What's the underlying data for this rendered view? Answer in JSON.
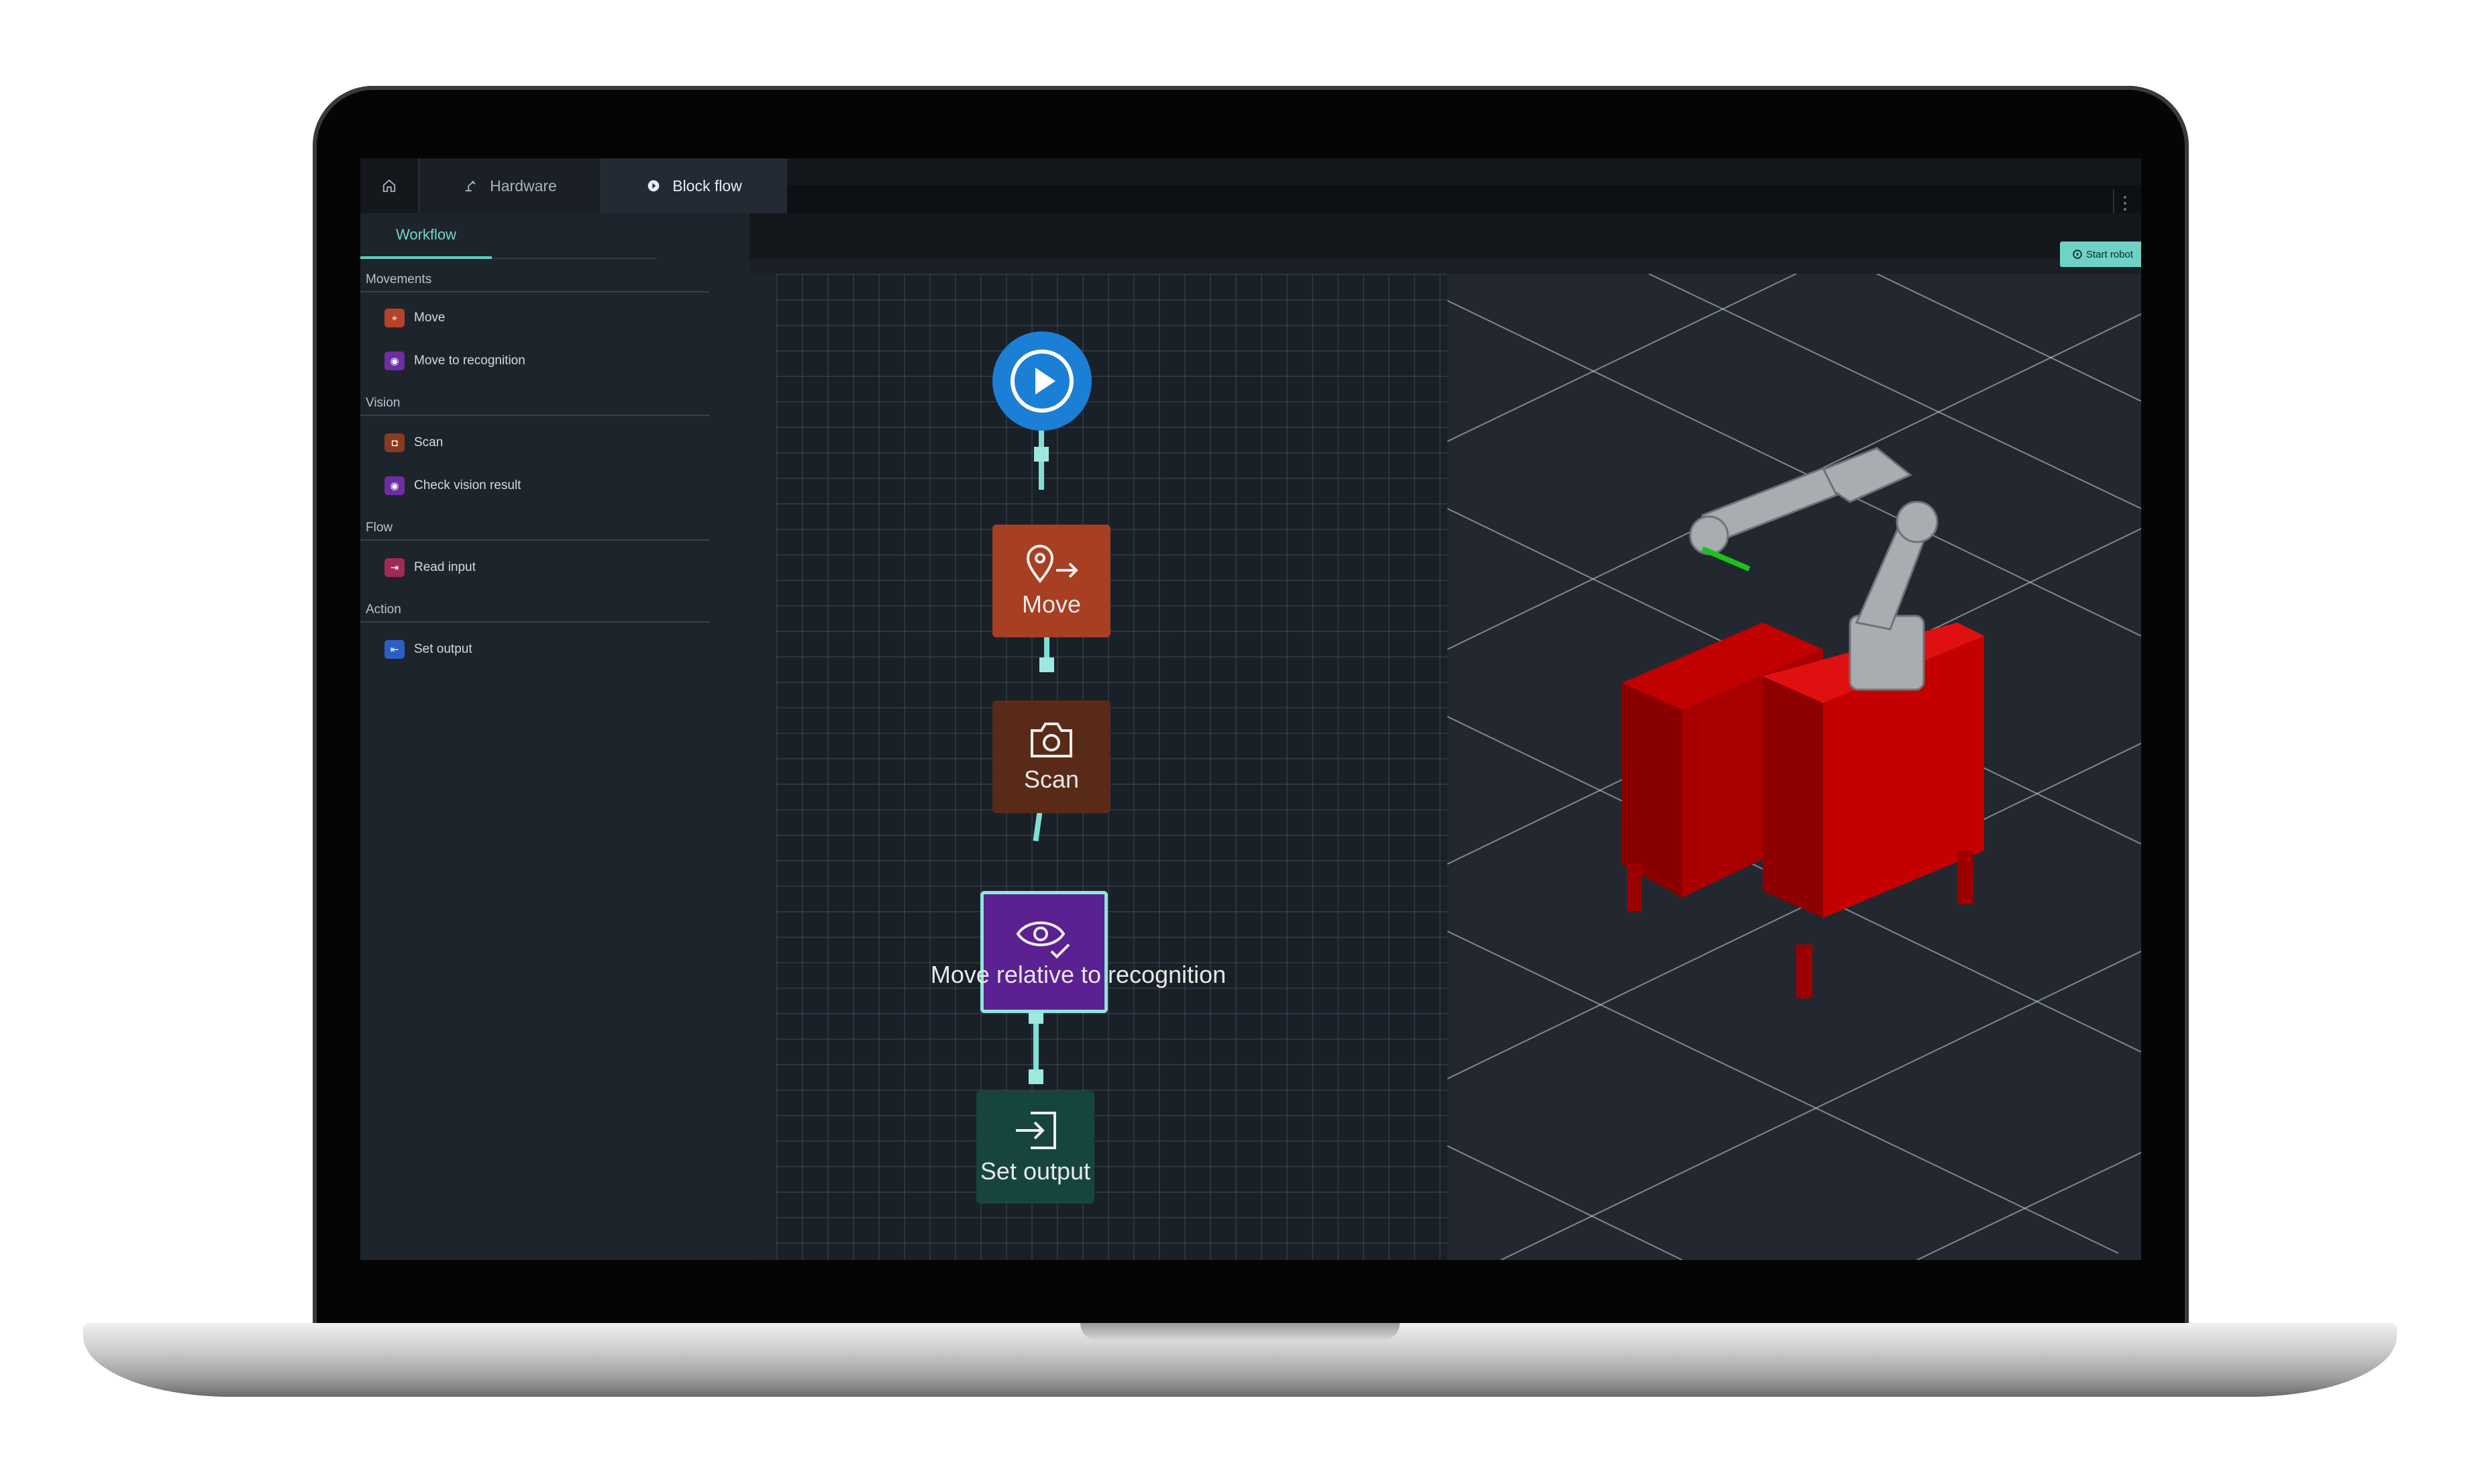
{
  "tabs": [
    {
      "label": "Hardware"
    },
    {
      "label": "Block flow"
    }
  ],
  "sidebar": {
    "tab": "Workflow",
    "sections": [
      {
        "title": "Movements",
        "items": [
          {
            "label": "Move",
            "color": "#b5432a"
          },
          {
            "label": "Move to recognition",
            "color": "#6b2fa0"
          }
        ]
      },
      {
        "title": "Vision",
        "items": [
          {
            "label": "Scan",
            "color": "#8a3a1f"
          },
          {
            "label": "Check vision result",
            "color": "#6b2fa0"
          }
        ]
      },
      {
        "title": "Flow",
        "items": [
          {
            "label": "Read input",
            "color": "#a02a55"
          }
        ]
      },
      {
        "title": "Action",
        "items": [
          {
            "label": "Set output",
            "color": "#2b5fc4"
          }
        ]
      }
    ]
  },
  "toolbar": {
    "start_robot": "Start robot"
  },
  "flow": {
    "blocks": [
      {
        "label": "Move",
        "icon": "location-arrow-icon",
        "color": "#a83f22"
      },
      {
        "label": "Scan",
        "icon": "camera-icon",
        "color": "#5a2a18"
      },
      {
        "label": "Move relative to recognition",
        "icon": "eye-check-icon",
        "color": "#5b2091"
      },
      {
        "label": "Set output",
        "icon": "sign-in-icon",
        "color": "#16453f"
      }
    ]
  }
}
